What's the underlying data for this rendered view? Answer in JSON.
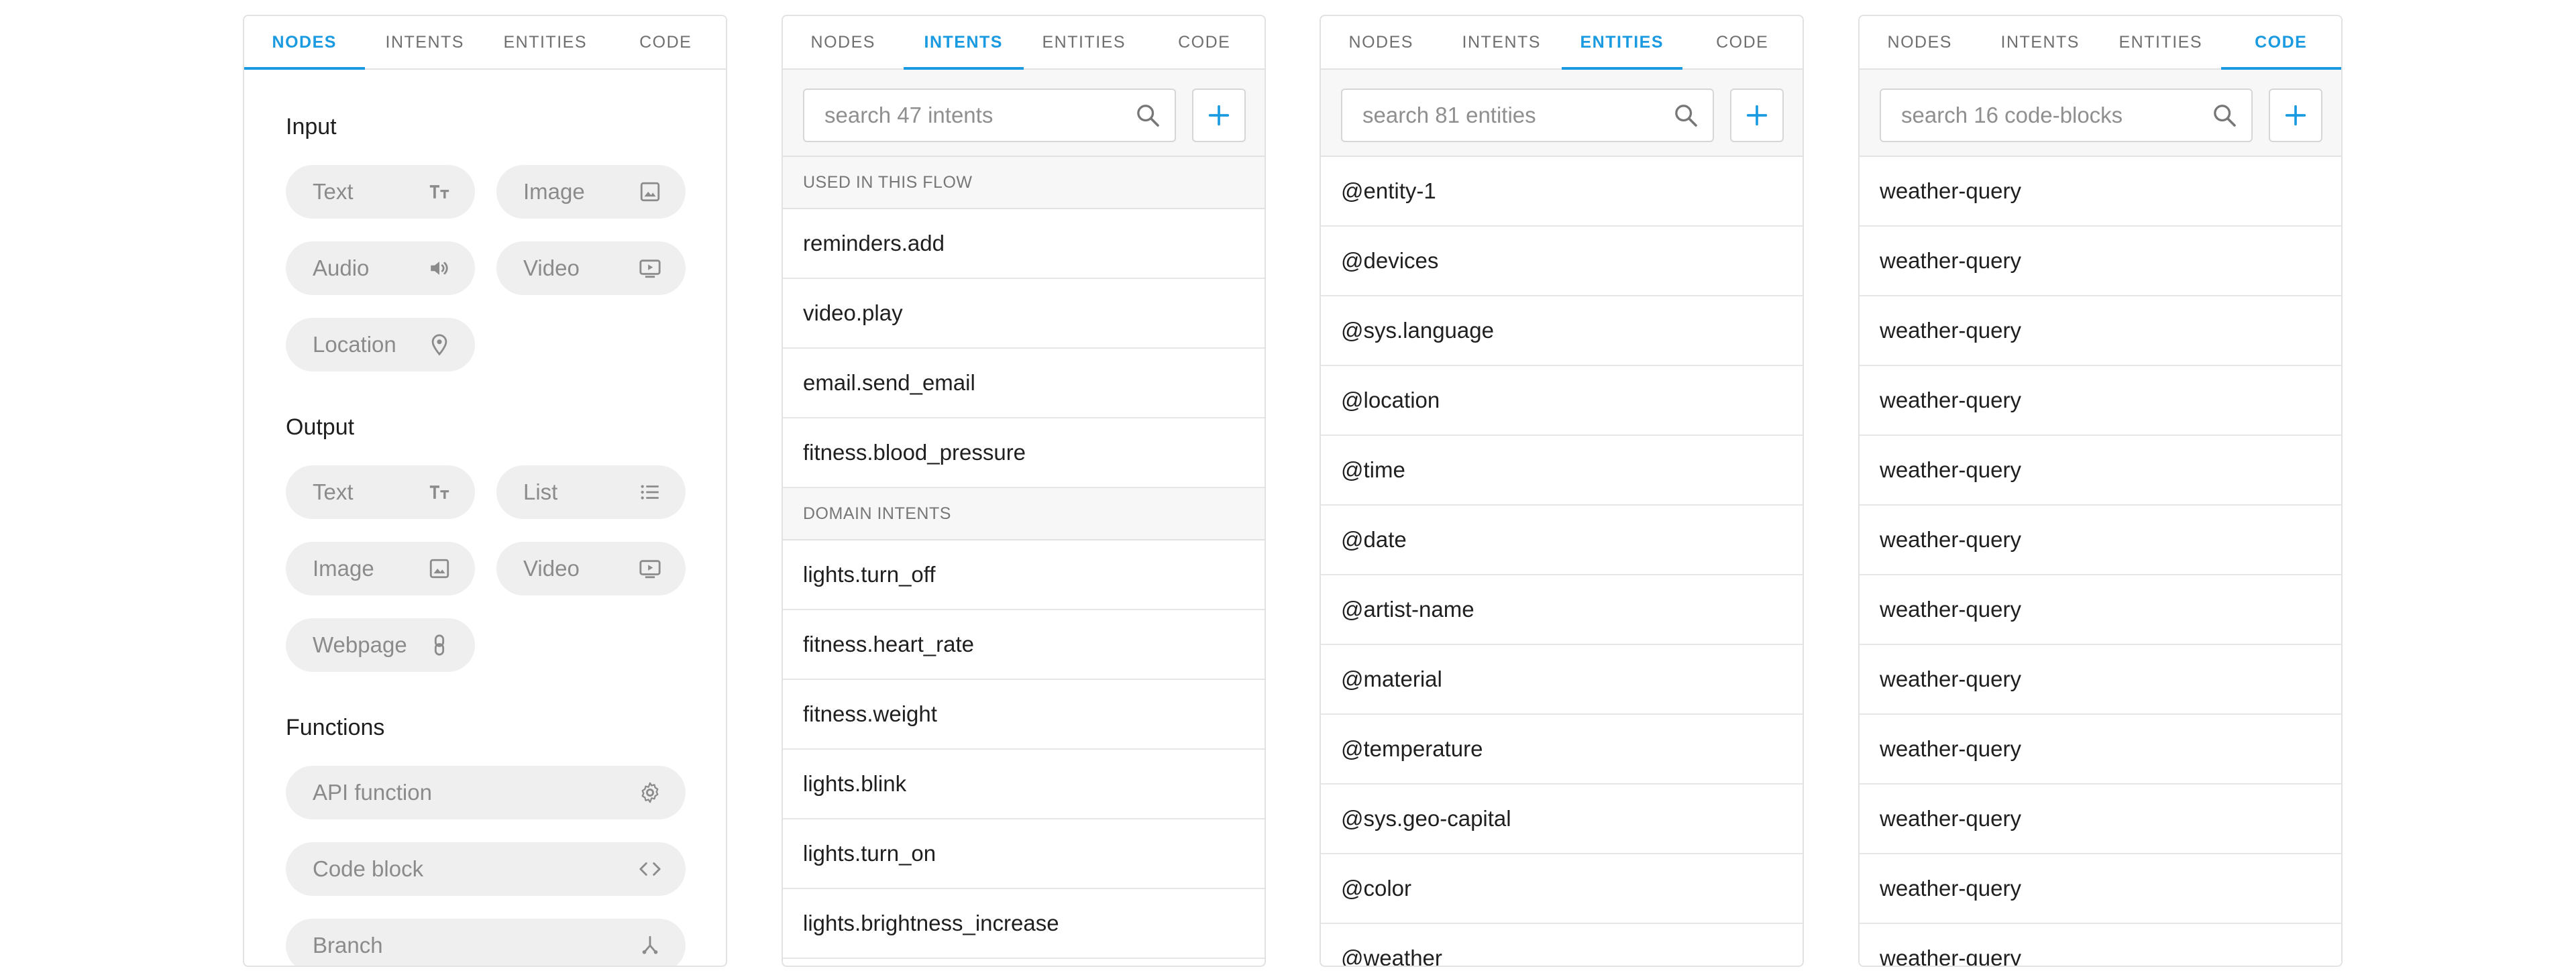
{
  "tabs": {
    "nodes": "NODES",
    "intents": "INTENTS",
    "entities": "ENTITIES",
    "code": "CODE"
  },
  "colors": {
    "accent": "#1a9ae0",
    "chip_bg": "#efefef",
    "divider": "#e2e2e2"
  },
  "nodes_panel": {
    "input_title": "Input",
    "output_title": "Output",
    "functions_title": "Functions",
    "input": [
      {
        "label": "Text",
        "icon": "text-format-icon"
      },
      {
        "label": "Image",
        "icon": "image-icon"
      },
      {
        "label": "Audio",
        "icon": "speaker-icon"
      },
      {
        "label": "Video",
        "icon": "video-icon"
      },
      {
        "label": "Location",
        "icon": "location-pin-icon"
      }
    ],
    "output": [
      {
        "label": "Text",
        "icon": "text-format-icon"
      },
      {
        "label": "List",
        "icon": "list-icon"
      },
      {
        "label": "Image",
        "icon": "image-icon"
      },
      {
        "label": "Video",
        "icon": "video-icon"
      },
      {
        "label": "Webpage",
        "icon": "link-icon"
      }
    ],
    "functions": [
      {
        "label": "API function",
        "icon": "gear-icon"
      },
      {
        "label": "Code block",
        "icon": "code-icon"
      },
      {
        "label": "Branch",
        "icon": "branch-icon"
      }
    ]
  },
  "intents_panel": {
    "search_placeholder": "search 47 intents",
    "add_label": "+",
    "group1_title": "USED IN THIS FLOW",
    "group1": [
      "reminders.add",
      "video.play",
      "email.send_email",
      "fitness.blood_pressure"
    ],
    "group2_title": "DOMAIN INTENTS",
    "group2": [
      "lights.turn_off",
      "fitness.heart_rate",
      "fitness.weight",
      "lights.blink",
      "lights.turn_on",
      "lights.brightness_increase"
    ]
  },
  "entities_panel": {
    "search_placeholder": "search 81 entities",
    "add_label": "+",
    "items": [
      "@entity-1",
      "@devices",
      "@sys.language",
      "@location",
      "@time",
      "@date",
      "@artist-name",
      "@material",
      "@temperature",
      "@sys.geo-capital",
      "@color",
      "@weather"
    ]
  },
  "code_panel": {
    "search_placeholder": "search 16 code-blocks",
    "add_label": "+",
    "items": [
      "weather-query",
      "weather-query",
      "weather-query",
      "weather-query",
      "weather-query",
      "weather-query",
      "weather-query",
      "weather-query",
      "weather-query",
      "weather-query",
      "weather-query",
      "weather-query"
    ]
  }
}
